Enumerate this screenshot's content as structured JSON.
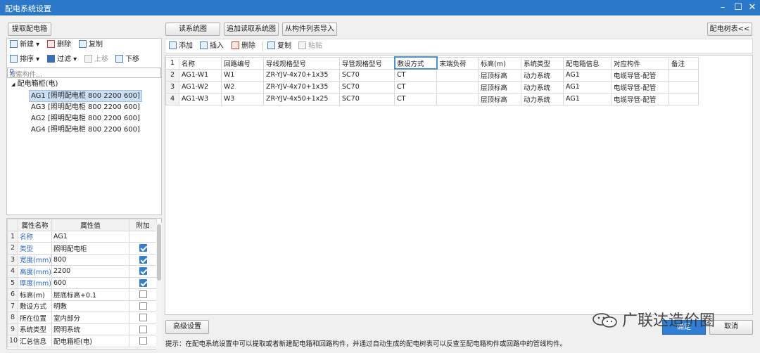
{
  "window": {
    "title": "配电系统设置",
    "min_icon": "minimize-icon",
    "max_icon": "maximize-icon",
    "close_icon": "close-icon"
  },
  "left": {
    "extract_button": "提取配电箱",
    "toolbar1": {
      "new": "新建",
      "delete": "删除",
      "copy": "复制"
    },
    "toolbar2": {
      "sort": "排序",
      "filter": "过滤",
      "up": "上移",
      "down": "下移"
    },
    "search_placeholder": "搜索构件...",
    "tree_root": "配电箱柜(电)",
    "tree_items": [
      "AG1 [照明配电柜 800 2200 600]",
      "AG3 [照明配电柜 800 2200 600]",
      "AG2 [照明配电柜 800 2200 600]",
      "AG4 [照明配电柜 800 2200 600]"
    ]
  },
  "props": {
    "headers": [
      "属性名称",
      "属性值",
      "附加"
    ],
    "rows": [
      {
        "n": "1",
        "name": "名称",
        "value": "AG1",
        "check": null
      },
      {
        "n": "2",
        "name": "类型",
        "value": "照明配电柜",
        "check": true
      },
      {
        "n": "3",
        "name": "宽度(mm)",
        "value": "800",
        "check": true
      },
      {
        "n": "4",
        "name": "高度(mm)",
        "value": "2200",
        "check": true
      },
      {
        "n": "5",
        "name": "厚度(mm)",
        "value": "600",
        "check": true
      },
      {
        "n": "6",
        "name": "标高(m)",
        "value": "层底标高+0.1",
        "check": false
      },
      {
        "n": "7",
        "name": "敷设方式",
        "value": "明敷",
        "check": false
      },
      {
        "n": "8",
        "name": "所在位置",
        "value": "室内部分",
        "check": false
      },
      {
        "n": "9",
        "name": "系统类型",
        "value": "照明系统",
        "check": false
      },
      {
        "n": "10",
        "name": "汇总信息",
        "value": "配电箱柜(电)",
        "check": false
      }
    ]
  },
  "top_buttons": {
    "read": "读系统图",
    "append": "追加读取系统图",
    "import": "从构件列表导入",
    "tree": "配电树表<<"
  },
  "grid_toolbar": {
    "add": "添加",
    "insert": "插入",
    "delete": "删除",
    "copy": "复制",
    "paste": "粘贴"
  },
  "grid": {
    "headers": [
      "名称",
      "回路编号",
      "导线规格型号",
      "导管规格型号",
      "敷设方式",
      "末端负荷",
      "标高(m)",
      "系统类型",
      "配电箱信息",
      "对应构件",
      "备注"
    ],
    "rows": [
      [
        "AG1-W1",
        "W1",
        "ZR-YJV-4x70+1x35",
        "SC70",
        "CT",
        "",
        "层顶标高",
        "动力系统",
        "AG1",
        "电缆导管-配管",
        ""
      ],
      [
        "AG1-W2",
        "W2",
        "ZR-YJV-4x70+1x35",
        "SC70",
        "CT",
        "",
        "层顶标高",
        "动力系统",
        "AG1",
        "电缆导管-配管",
        ""
      ],
      [
        "AG1-W3",
        "W3",
        "ZR-YJV-4x50+1x25",
        "SC70",
        "CT",
        "",
        "层顶标高",
        "动力系统",
        "AG1",
        "电缆导管-配管",
        ""
      ]
    ]
  },
  "advanced_button": "高级设置",
  "ok_button": "确定",
  "cancel_button": "取消",
  "hint": "提示：在配电系统设置中可以提取或者新建配电箱和回路构件，并通过自动生成的配电树表可以反查至配电箱构件或回路中的管线构件。",
  "watermark": "广联达造价圈"
}
